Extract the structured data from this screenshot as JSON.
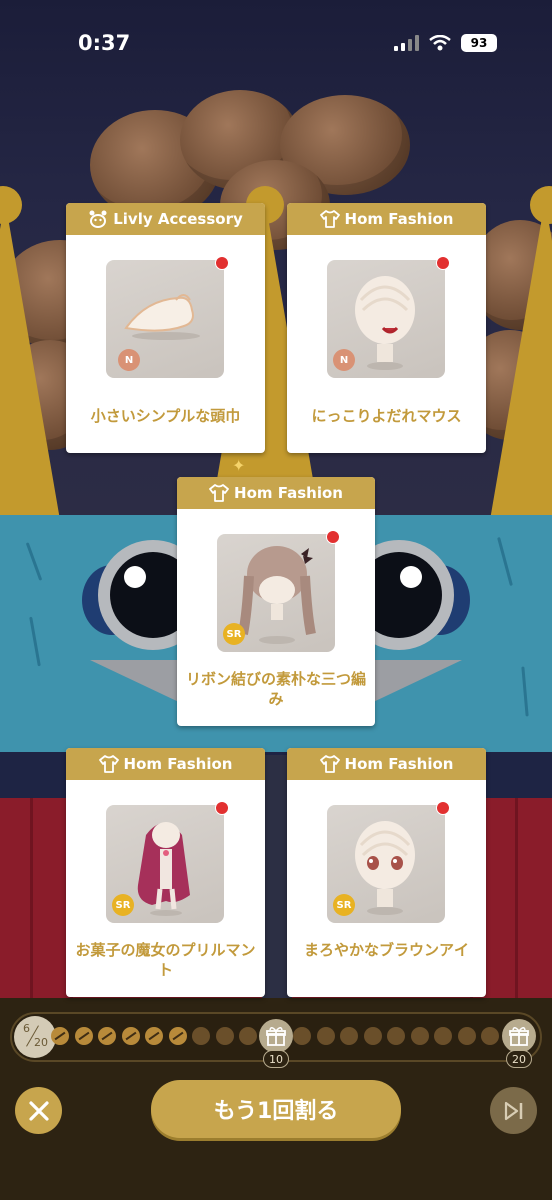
{
  "status_bar": {
    "time": "0:37",
    "battery": "93"
  },
  "cards": [
    {
      "category": "Livly Accessory",
      "category_icon": "paw-icon",
      "name": "小さいシンプルな頭巾",
      "rarity": "N",
      "new": true
    },
    {
      "category": "Hom Fashion",
      "category_icon": "shirt-icon",
      "name": "にっこりよだれマウス",
      "rarity": "N",
      "new": true
    },
    {
      "category": "Hom Fashion",
      "category_icon": "shirt-icon",
      "name": "リボン結びの素朴な三つ編み",
      "rarity": "SR",
      "new": true
    },
    {
      "category": "Hom Fashion",
      "category_icon": "shirt-icon",
      "name": "お菓子の魔女のプリルマント",
      "rarity": "SR",
      "new": true
    },
    {
      "category": "Hom Fashion",
      "category_icon": "shirt-icon",
      "name": "まろやかなブラウンアイ",
      "rarity": "SR",
      "new": true
    }
  ],
  "progress": {
    "current": "6",
    "total": "20",
    "opened_count": 6,
    "milestones": [
      {
        "label": "10"
      },
      {
        "label": "20"
      }
    ]
  },
  "buttons": {
    "close_icon": "close-icon",
    "main_label": "もう1回割る",
    "skip_icon": "skip-icon"
  },
  "colors": {
    "gold": "#c7a54d",
    "text_gold": "#c29a3c",
    "new_dot": "#e23030",
    "rarity_n": "#d99275",
    "rarity_sr": "#e8b223"
  }
}
